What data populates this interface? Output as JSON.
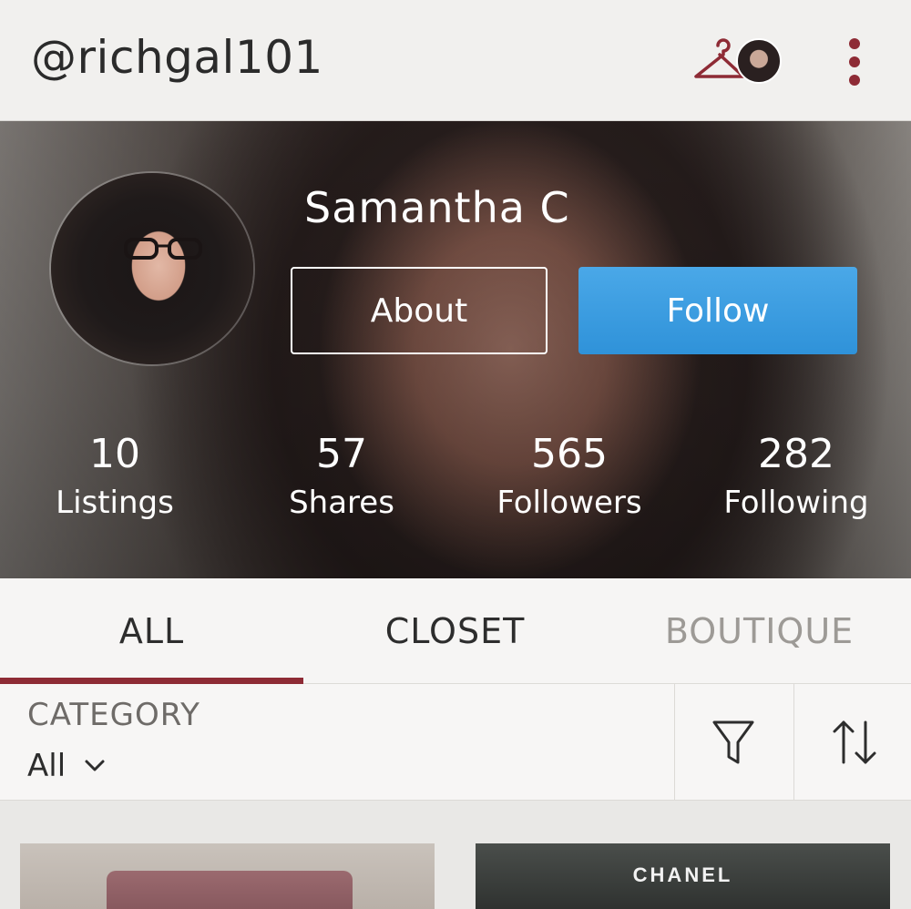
{
  "header": {
    "username": "@richgal101",
    "icons": [
      "hanger-icon",
      "avatar",
      "more-vertical-icon"
    ]
  },
  "profile": {
    "name": "Samantha C",
    "about_label": "About",
    "follow_label": "Follow",
    "stats": [
      {
        "value": "10",
        "label": "Listings"
      },
      {
        "value": "57",
        "label": "Shares"
      },
      {
        "value": "565",
        "label": "Followers"
      },
      {
        "value": "282",
        "label": "Following"
      }
    ]
  },
  "tabs": [
    {
      "label": "ALL",
      "active": true
    },
    {
      "label": "CLOSET",
      "active": false
    },
    {
      "label": "BOUTIQUE",
      "active": false,
      "disabled": true
    }
  ],
  "filter": {
    "category_label": "CATEGORY",
    "category_value": "All",
    "icons": [
      "filter-icon",
      "sort-icon"
    ]
  },
  "listings": [
    {
      "brand": ""
    },
    {
      "brand": "CHANEL"
    }
  ],
  "colors": {
    "accent": "#8e2b35",
    "follow_button": "#3a9be0",
    "background": "#ecebe9"
  }
}
